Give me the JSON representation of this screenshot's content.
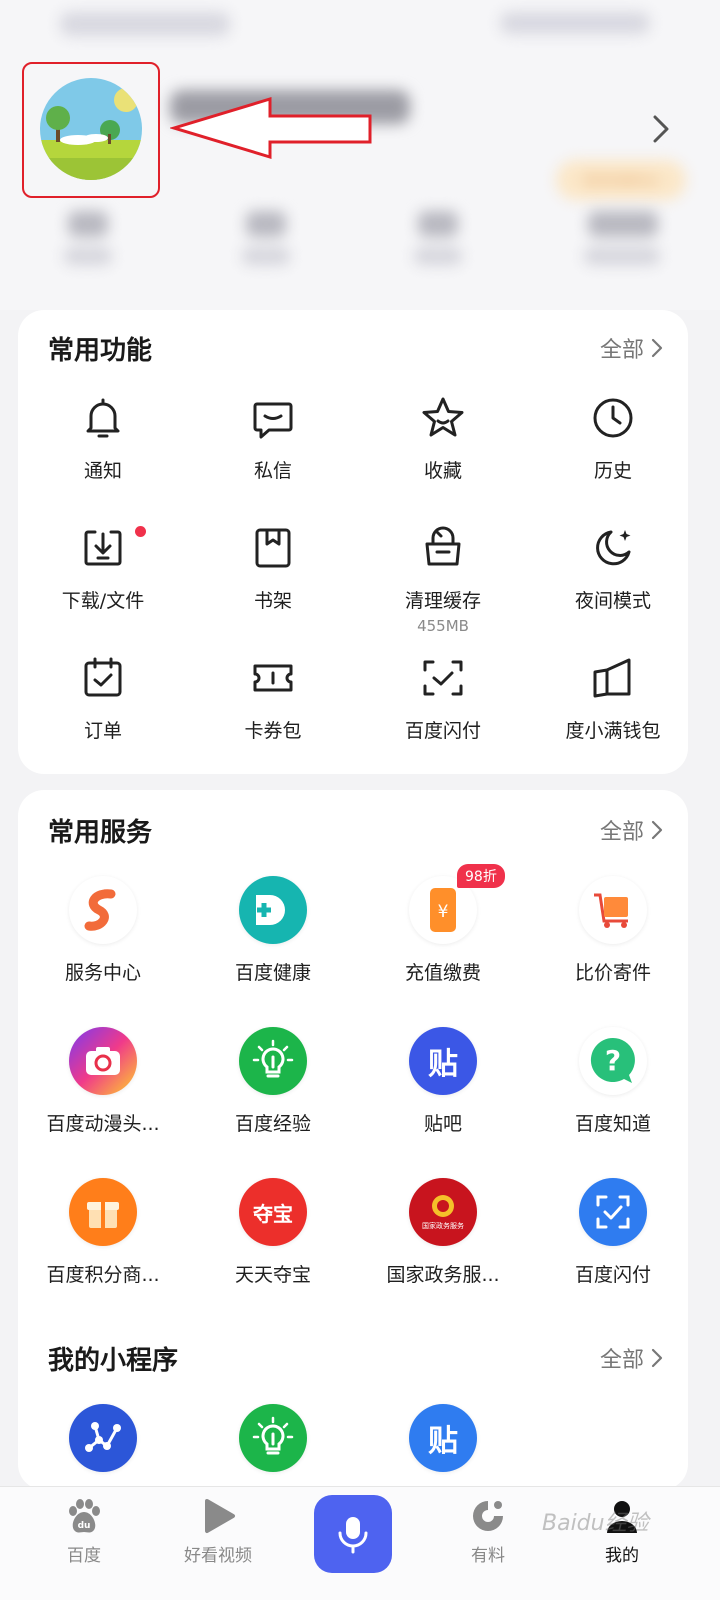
{
  "profile": {
    "points_label": "签到领积分"
  },
  "common_functions": {
    "title": "常用功能",
    "all_label": "全部",
    "items": [
      {
        "label": "通知",
        "icon": "bell-icon"
      },
      {
        "label": "私信",
        "icon": "message-icon"
      },
      {
        "label": "收藏",
        "icon": "star-icon"
      },
      {
        "label": "历史",
        "icon": "clock-icon"
      },
      {
        "label": "下载/文件",
        "icon": "download-icon"
      },
      {
        "label": "书架",
        "icon": "bookmark-icon"
      },
      {
        "label": "清理缓存",
        "icon": "trash-icon",
        "sub": "455MB"
      },
      {
        "label": "夜间模式",
        "icon": "moon-icon"
      },
      {
        "label": "订单",
        "icon": "calendar-check-icon"
      },
      {
        "label": "卡券包",
        "icon": "ticket-icon"
      },
      {
        "label": "百度闪付",
        "icon": "scan-check-icon"
      },
      {
        "label": "度小满钱包",
        "icon": "wallet-icon"
      }
    ]
  },
  "common_services": {
    "title": "常用服务",
    "all_label": "全部",
    "badge": "98折",
    "items": [
      {
        "label": "服务中心",
        "icon": "service-center-icon"
      },
      {
        "label": "百度健康",
        "icon": "health-icon"
      },
      {
        "label": "充值缴费",
        "icon": "recharge-icon"
      },
      {
        "label": "比价寄件",
        "icon": "delivery-icon"
      },
      {
        "label": "百度动漫头...",
        "icon": "camera-icon"
      },
      {
        "label": "百度经验",
        "icon": "lightbulb-icon"
      },
      {
        "label": "贴吧",
        "icon": "tieba-icon",
        "glyph": "贴"
      },
      {
        "label": "百度知道",
        "icon": "question-icon"
      },
      {
        "label": "百度积分商...",
        "icon": "gift-icon"
      },
      {
        "label": "天天夺宝",
        "icon": "treasure-icon",
        "glyph": "夺宝"
      },
      {
        "label": "国家政务服...",
        "icon": "government-icon",
        "glyph": "国家政务服务"
      },
      {
        "label": "百度闪付",
        "icon": "scan-pay-icon"
      }
    ]
  },
  "mini_programs": {
    "title": "我的小程序",
    "all_label": "全部",
    "items": [
      {
        "icon": "network-icon"
      },
      {
        "icon": "lightbulb-icon"
      },
      {
        "icon": "tieba-icon",
        "glyph": "贴"
      }
    ]
  },
  "tabbar": {
    "items": [
      {
        "label": "百度",
        "icon": "baidu-paw-icon"
      },
      {
        "label": "好看视频",
        "icon": "play-icon"
      },
      {
        "label": "",
        "icon": "mic-icon"
      },
      {
        "label": "有料",
        "icon": "youliao-icon"
      },
      {
        "label": "我的",
        "icon": "profile-icon",
        "active": true
      }
    ]
  },
  "watermark": "Baidu经验",
  "colors": {
    "accent": "#4e63f0",
    "badge_red": "#f0314b",
    "annotation_red": "#e0202a"
  }
}
